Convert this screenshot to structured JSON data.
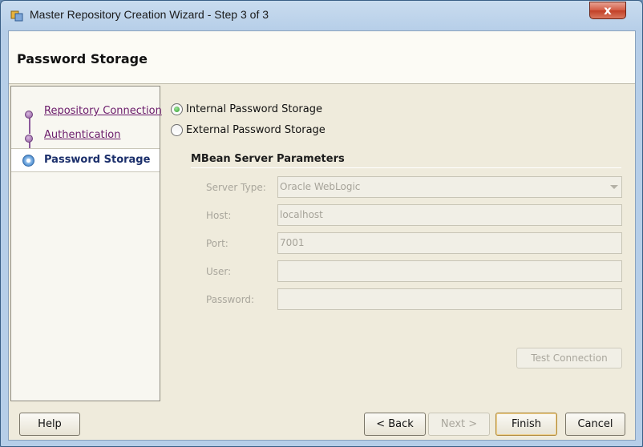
{
  "window": {
    "title": "Master Repository Creation Wizard - Step 3 of 3",
    "close_label": "x"
  },
  "header": {
    "title": "Password Storage"
  },
  "steps": [
    {
      "label": "Repository Connection",
      "state": "visited"
    },
    {
      "label": "Authentication",
      "state": "visited"
    },
    {
      "label": "Password Storage",
      "state": "active"
    }
  ],
  "storage_options": {
    "internal": {
      "label": "Internal Password Storage",
      "checked": true
    },
    "external": {
      "label": "External Password Storage",
      "checked": false
    }
  },
  "mbean": {
    "section_title": "MBean Server Parameters",
    "server_type": {
      "label": "Server Type:",
      "value": "Oracle WebLogic"
    },
    "host": {
      "label": "Host:",
      "value": "localhost"
    },
    "port": {
      "label": "Port:",
      "value": "7001"
    },
    "user": {
      "label": "User:",
      "value": ""
    },
    "password": {
      "label": "Password:",
      "value": ""
    },
    "test_connection_label": "Test Connection"
  },
  "footer": {
    "help_label": "Help",
    "back_label": "< Back",
    "next_label": "Next >",
    "finish_label": "Finish",
    "cancel_label": "Cancel"
  },
  "colors": {
    "visited_step": "#6a1a6a",
    "active_step": "#1b2f6b",
    "radio_selected": "#2e9a2a",
    "close_button": "#c13f26"
  }
}
